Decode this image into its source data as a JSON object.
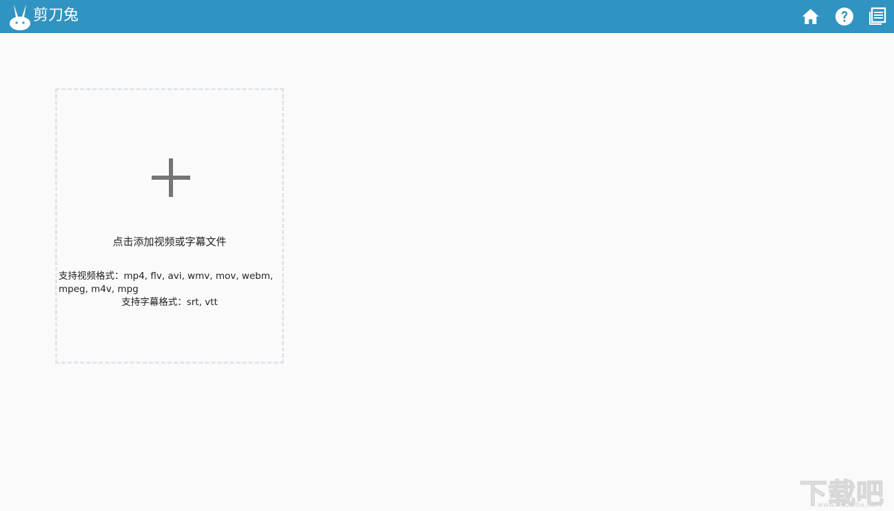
{
  "app": {
    "title": "剪刀兔"
  },
  "toolbar": {
    "home_icon": "home-icon",
    "help_icon": "help-icon",
    "docs_icon": "document-list-icon"
  },
  "dropzone": {
    "prompt": "点击添加视频或字幕文件",
    "video_formats": "支持视频格式：mp4, flv, avi, wmv, mov, webm, mpeg, m4v, mpg",
    "subtitle_formats": "支持字幕格式：srt, vtt"
  },
  "watermark": {
    "text": "下载吧",
    "url": "www.xiazaiba.com"
  },
  "colors": {
    "titlebar": "#3193c1",
    "background": "#fafafa",
    "plus": "#757575",
    "dropzone_border": "#dfe6ee"
  }
}
